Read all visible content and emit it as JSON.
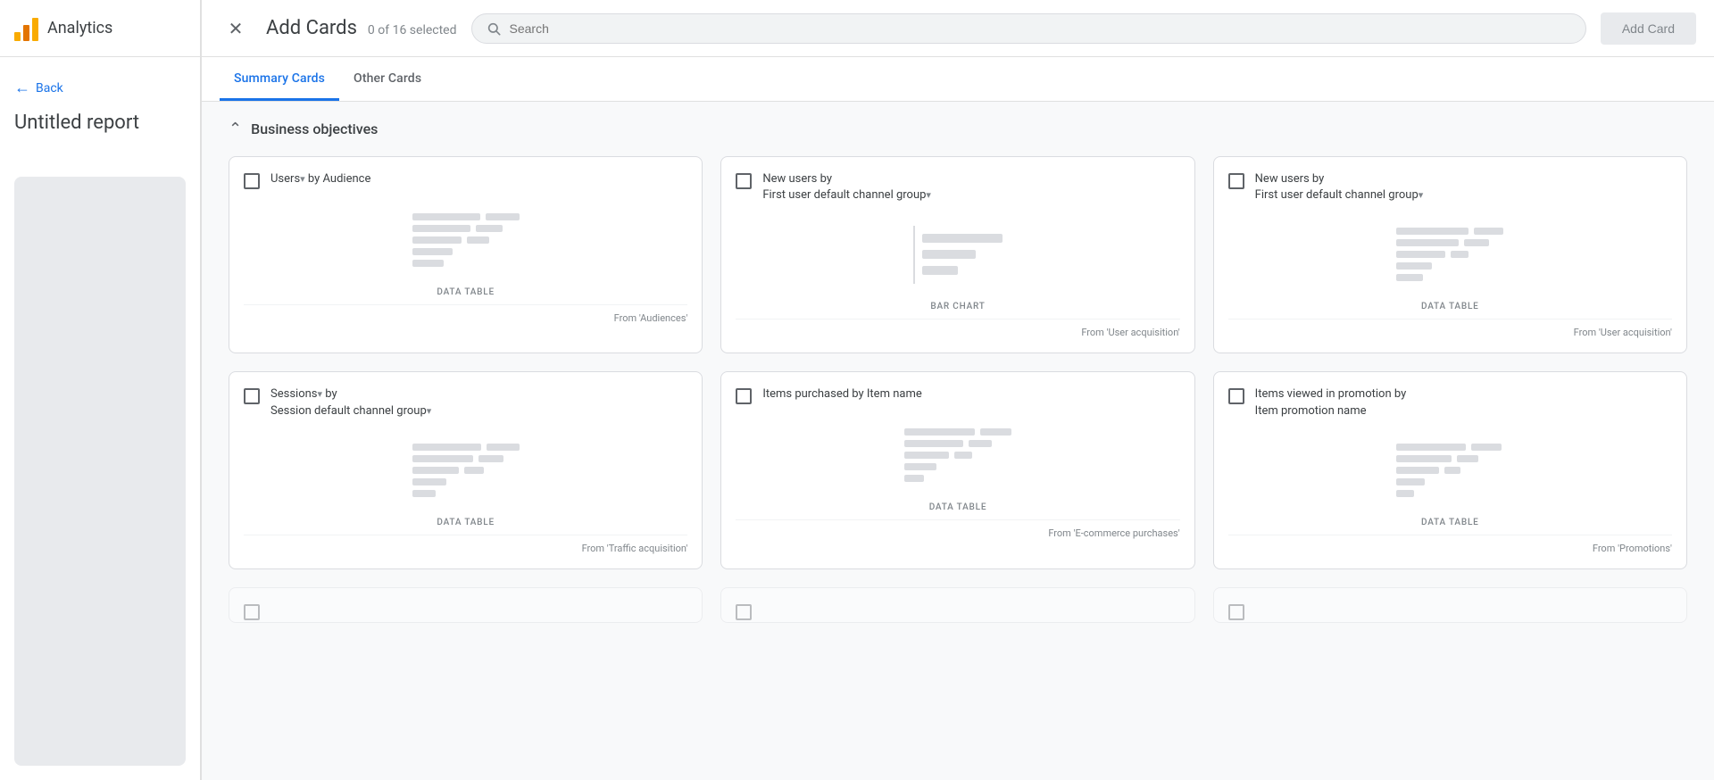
{
  "app": {
    "name": "Analytics",
    "logo_colors": [
      "#f9ab00",
      "#e37400",
      "#f9ab00"
    ]
  },
  "sidebar": {
    "back_label": "Back",
    "report_title": "Untitled report"
  },
  "top_bar": {
    "title": "Add Cards",
    "selected_count": "0 of 16 selected",
    "search_placeholder": "Search",
    "add_card_label": "Add Card"
  },
  "tabs": [
    {
      "id": "summary",
      "label": "Summary Cards",
      "active": true
    },
    {
      "id": "other",
      "label": "Other Cards",
      "active": false
    }
  ],
  "section": {
    "title": "Business objectives"
  },
  "cards": [
    {
      "id": "card-1",
      "title": "Users",
      "title_suffix": " by Audience",
      "has_dropdown": true,
      "type": "DATA TABLE",
      "source": "From 'Audiences'",
      "preview": "table",
      "checked": false
    },
    {
      "id": "card-2",
      "title": "New users by",
      "title_line2": "First user default channel group",
      "has_dropdown": true,
      "type": "BAR CHART",
      "source": "From 'User acquisition'",
      "preview": "bar",
      "checked": false
    },
    {
      "id": "card-3",
      "title": "New users by",
      "title_line2": "First user default channel group",
      "has_dropdown": true,
      "type": "DATA TABLE",
      "source": "From 'User acquisition'",
      "preview": "table",
      "checked": false
    },
    {
      "id": "card-4",
      "title": "Sessions",
      "title_suffix": " by",
      "title_line2": "Session default channel group",
      "has_dropdown": true,
      "type": "DATA TABLE",
      "source": "From 'Traffic acquisition'",
      "preview": "table",
      "checked": false
    },
    {
      "id": "card-5",
      "title": "Items purchased by Item name",
      "has_dropdown": false,
      "type": "DATA TABLE",
      "source": "From 'E-commerce purchases'",
      "preview": "table",
      "checked": false
    },
    {
      "id": "card-6",
      "title": "Items viewed in promotion by",
      "title_line2": "Item promotion name",
      "has_dropdown": false,
      "type": "DATA TABLE",
      "source": "From 'Promotions'",
      "preview": "table",
      "checked": false
    }
  ]
}
